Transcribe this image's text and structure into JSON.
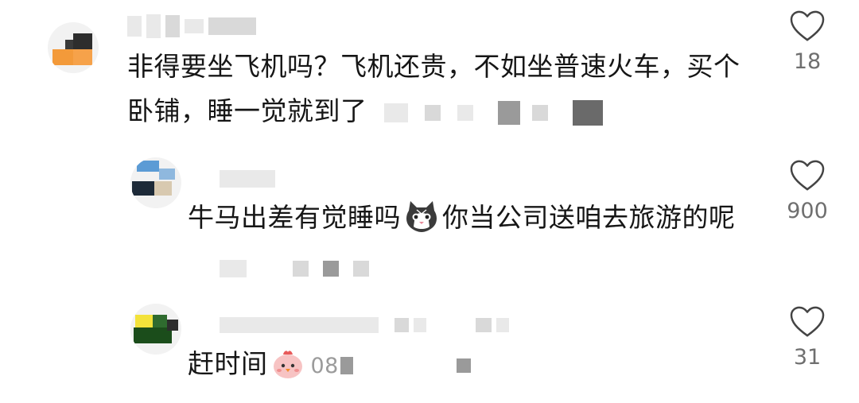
{
  "comments": [
    {
      "text": "非得要坐飞机吗？飞机还贵，不如坐普速火车，买个",
      "text_line2": "卧铺，睡一觉就到了",
      "likes": "18",
      "avatar_icon": "user-avatar-icon"
    },
    {
      "text_part1": "牛马出差有觉睡吗",
      "text_part2": "你当公司送咱去旅游的呢",
      "emoji_icon": "cat-emoji-icon",
      "likes": "900"
    },
    {
      "text": "赶时间",
      "emoji_icon": "chick-emoji-icon",
      "meta_text": "08",
      "likes": "31"
    }
  ],
  "icons": {
    "like": "heart-outline-icon"
  },
  "colors": {
    "text": "#161616",
    "meta": "#9b9b9b",
    "like_count": "#6f6f6f",
    "icon_stroke": "#444444"
  }
}
